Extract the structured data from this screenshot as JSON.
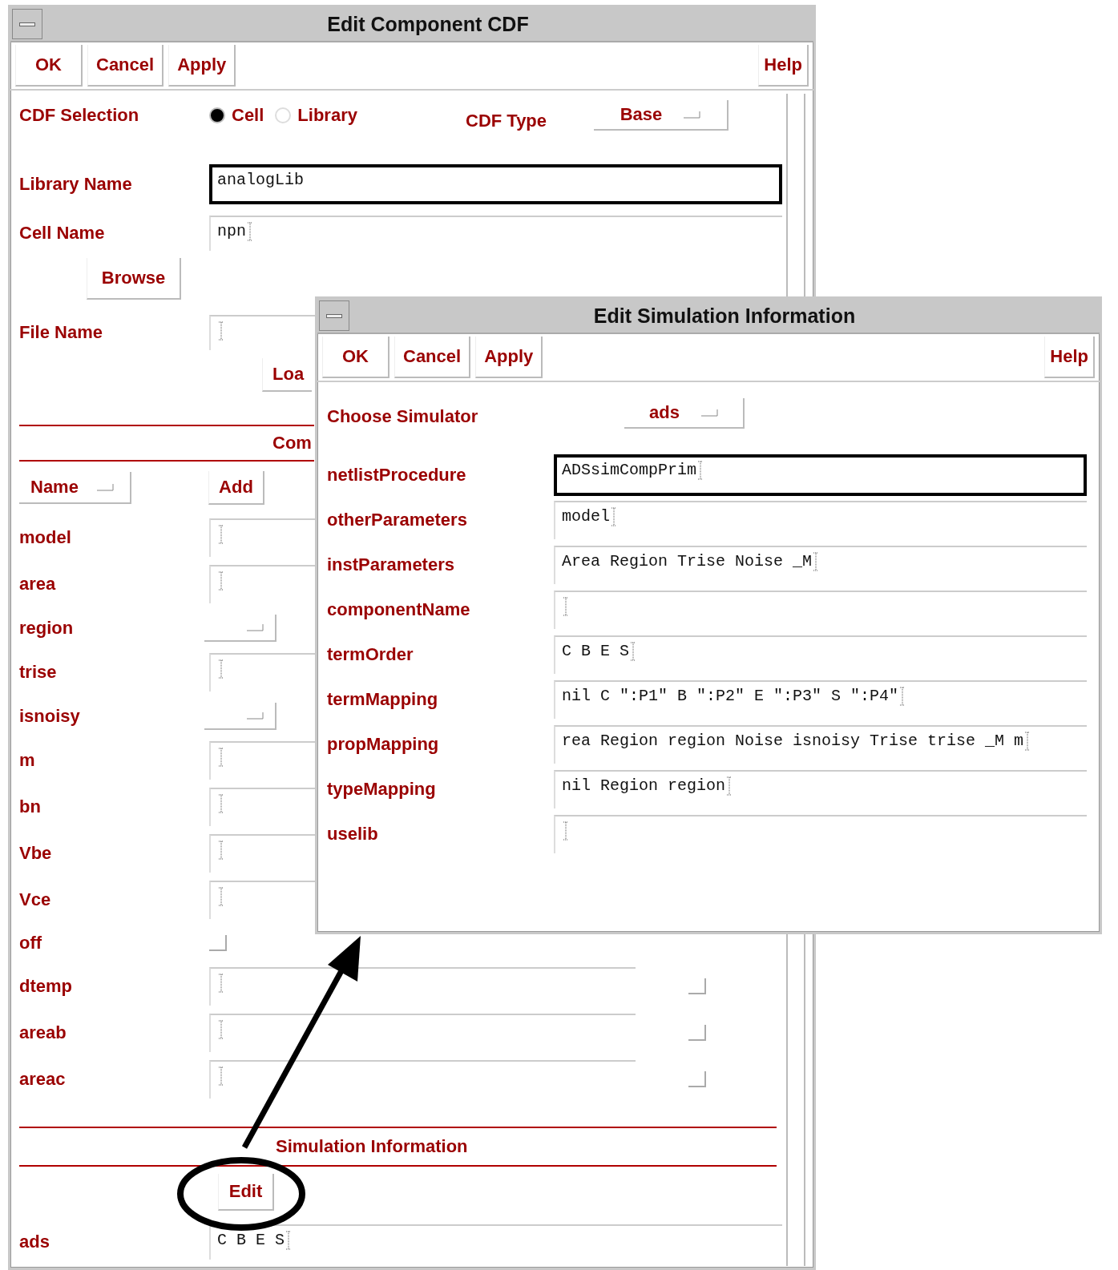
{
  "main_dialog": {
    "title": "Edit Component CDF",
    "buttons": [
      "OK",
      "Cancel",
      "Apply"
    ],
    "help": "Help",
    "cdf_selection": {
      "label": "CDF Selection",
      "options": [
        {
          "label": "Cell",
          "selected": true
        },
        {
          "label": "Library",
          "selected": false
        }
      ]
    },
    "cdf_type": {
      "label": "CDF Type",
      "value": "Base"
    },
    "library_name": {
      "label": "Library Name",
      "value": "analogLib",
      "focused": true
    },
    "cell_name": {
      "label": "Cell Name",
      "value": "npn",
      "focused": false
    },
    "browse_button": "Browse",
    "file_name": {
      "label": "File Name"
    },
    "load_button": "Loa",
    "section_1": "Com",
    "sort_menu": "Name",
    "add_button": "Add",
    "parameters": [
      {
        "name": "model",
        "kind": "text"
      },
      {
        "name": "area",
        "kind": "text"
      },
      {
        "name": "region",
        "kind": "cyclic"
      },
      {
        "name": "trise",
        "kind": "text"
      },
      {
        "name": "isnoisy",
        "kind": "cyclic"
      },
      {
        "name": "m",
        "kind": "text"
      },
      {
        "name": "bn",
        "kind": "text"
      },
      {
        "name": "Vbe",
        "kind": "text"
      },
      {
        "name": "Vce",
        "kind": "text"
      },
      {
        "name": "off",
        "kind": "boolean",
        "checked": false
      },
      {
        "name": "dtemp",
        "kind": "text",
        "checked": false
      },
      {
        "name": "areab",
        "kind": "text",
        "checked": false
      },
      {
        "name": "areac",
        "kind": "text",
        "checked": false
      }
    ],
    "section_2": "Simulation Information",
    "edit_button": "Edit",
    "simulators": [
      {
        "name": "ads",
        "value": "C B E S"
      }
    ]
  },
  "sim_dialog": {
    "title": "Edit Simulation Information",
    "buttons": [
      "OK",
      "Cancel",
      "Apply"
    ],
    "help": "Help",
    "simulator": {
      "label": "Choose Simulator",
      "value": "ads"
    },
    "fields": [
      {
        "label": "netlistProcedure",
        "value": "ADSsimCompPrim",
        "focused": true
      },
      {
        "label": "otherParameters",
        "value": "model",
        "focused": false
      },
      {
        "label": "instParameters",
        "value": "Area Region Trise Noise _M",
        "focused": false
      },
      {
        "label": "componentName",
        "focused": false
      },
      {
        "label": "termOrder",
        "value": "C B E S",
        "focused": false
      },
      {
        "label": "termMapping",
        "value": "nil C \":P1\" B \":P2\" E \":P3\" S \":P4\"",
        "focused": false
      },
      {
        "label": "propMapping",
        "value": "rea Region region Noise isnoisy Trise trise _M m",
        "focused": false
      },
      {
        "label": "typeMapping",
        "value": "nil Region region",
        "focused": false
      },
      {
        "label": "uselib",
        "focused": false
      }
    ]
  }
}
